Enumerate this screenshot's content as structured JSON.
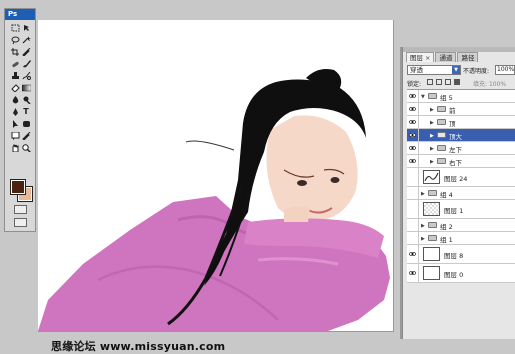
{
  "app": {
    "badge": "Ps"
  },
  "toolbox": {
    "tools": [
      "marquee-tool",
      "move-tool",
      "lasso-tool",
      "magic-wand-tool",
      "crop-tool",
      "eyedropper-tool",
      "healing-brush-tool",
      "brush-tool",
      "clone-stamp-tool",
      "history-brush-tool",
      "eraser-tool",
      "gradient-tool",
      "blur-tool",
      "dodge-tool",
      "pen-tool",
      "type-tool",
      "path-selection-tool",
      "shape-tool",
      "notes-tool",
      "eyedropper-tool-2",
      "hand-tool",
      "zoom-tool"
    ],
    "type_glyph": "T",
    "foreground_color": "#4a2210",
    "background_color": "#e8b89a"
  },
  "canvas": {
    "watermark": "思缘论坛 www.missyuan.com"
  },
  "layers_panel": {
    "tabs": [
      {
        "label": "图层",
        "close": "×"
      },
      {
        "label": "通道"
      },
      {
        "label": "路径"
      }
    ],
    "blend_mode": "穿透",
    "opacity_label": "不透明度:",
    "opacity_value": "100%",
    "lock_label": "锁定:",
    "fill_label": "填充:",
    "fill_value": "100%",
    "layers": [
      {
        "name": "组 5",
        "type": "group",
        "visible": true,
        "expanded": true,
        "indent": 0,
        "selected": false
      },
      {
        "name": "前",
        "type": "group",
        "visible": true,
        "expanded": false,
        "indent": 1,
        "selected": false
      },
      {
        "name": "顶",
        "type": "group",
        "visible": true,
        "expanded": false,
        "indent": 1,
        "selected": false
      },
      {
        "name": "顶大",
        "type": "group",
        "visible": true,
        "expanded": false,
        "indent": 1,
        "selected": true
      },
      {
        "name": "左下",
        "type": "group",
        "visible": true,
        "expanded": false,
        "indent": 1,
        "selected": false
      },
      {
        "name": "右下",
        "type": "group",
        "visible": true,
        "expanded": false,
        "indent": 1,
        "selected": false
      },
      {
        "name": "图层 24",
        "type": "layer",
        "visible": false,
        "thumb": "stroke"
      },
      {
        "name": "组 4",
        "type": "group",
        "visible": false,
        "expanded": false,
        "indent": 0,
        "selected": false
      },
      {
        "name": "图层 1",
        "type": "layer",
        "visible": false,
        "thumb": "checker"
      },
      {
        "name": "组 2",
        "type": "group",
        "visible": false,
        "expanded": false,
        "indent": 0,
        "selected": false
      },
      {
        "name": "组 1",
        "type": "group",
        "visible": false,
        "expanded": false,
        "indent": 0,
        "selected": false
      },
      {
        "name": "图层 8",
        "type": "layer",
        "visible": true,
        "thumb": "white"
      },
      {
        "name": "图层 0",
        "type": "layer",
        "visible": true,
        "thumb": "white"
      }
    ]
  }
}
